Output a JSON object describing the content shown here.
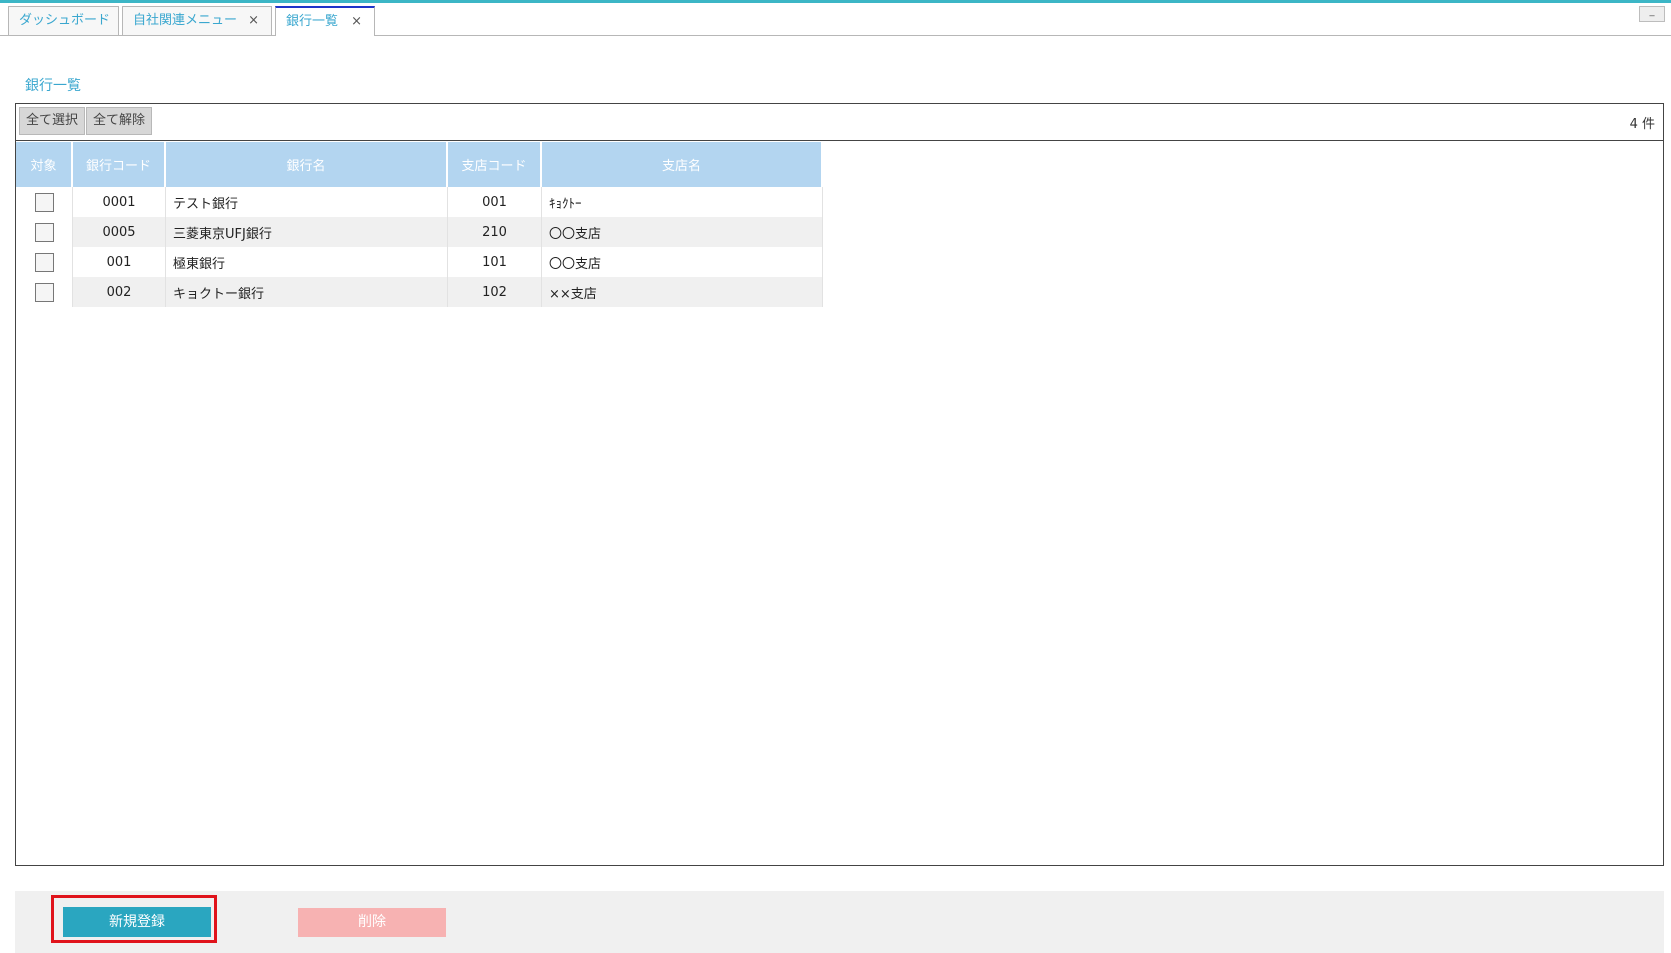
{
  "tabs": [
    {
      "label": "ダッシュボード",
      "closable": false,
      "active": false
    },
    {
      "label": "自社関連メニュー",
      "closable": true,
      "active": false
    },
    {
      "label": "銀行一覧",
      "closable": true,
      "active": true
    }
  ],
  "tab_close_glyph": "×",
  "minimize_glyph": "_",
  "page_title": "銀行一覧",
  "toolbar": {
    "select_all": "全て選択",
    "deselect_all": "全て解除",
    "count": "4 件"
  },
  "table": {
    "headers": [
      "対象",
      "銀行コード",
      "銀行名",
      "支店コード",
      "支店名"
    ],
    "rows": [
      {
        "checked": false,
        "bank_code": "0001",
        "bank_name": "テスト銀行",
        "branch_code": "001",
        "branch_name": "ｷｮｸﾄｰ"
      },
      {
        "checked": false,
        "bank_code": "0005",
        "bank_name": "三菱東京UFJ銀行",
        "branch_code": "210",
        "branch_name": "〇〇支店"
      },
      {
        "checked": false,
        "bank_code": "001",
        "bank_name": "極東銀行",
        "branch_code": "101",
        "branch_name": "〇〇支店"
      },
      {
        "checked": false,
        "bank_code": "002",
        "bank_name": "キョクトー銀行",
        "branch_code": "102",
        "branch_name": "××支店"
      }
    ]
  },
  "footer": {
    "new_label": "新規登録",
    "delete_label": "削除"
  },
  "colors": {
    "accent": "#3aa7cf",
    "header_bg": "#b3d5f0",
    "new_button": "#2aa6c0",
    "delete_button": "#f7b2b2",
    "highlight": "#e0131b"
  }
}
